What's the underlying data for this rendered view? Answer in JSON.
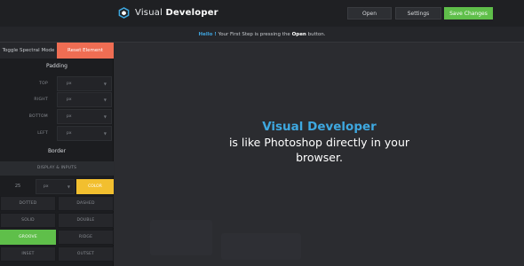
{
  "topbar": {
    "app_name_light": "Visual",
    "app_name_bold": "Developer",
    "logo_icon": "hexagon-logo-icon",
    "buttons": {
      "open": "Open",
      "settings": "Settings",
      "save": "Save Changes"
    },
    "save_color": "#5fbf4a"
  },
  "hint": {
    "hello": "Hello !",
    "text_before": "Your First Step is pressing the",
    "open_word": "Open",
    "text_after": "button."
  },
  "panel": {
    "spectral_button": "Toggle Spectral Mode",
    "reset_button": "Reset Element",
    "reset_color": "#ef6d53",
    "padding_title": "Padding",
    "padding_rows": [
      {
        "label": "TOP",
        "unit": "px"
      },
      {
        "label": "RIGHT",
        "unit": "px"
      },
      {
        "label": "BOTTOM",
        "unit": "px"
      },
      {
        "label": "LEFT",
        "unit": "px"
      }
    ],
    "border_title": "Border",
    "display_bar": "DISPLAY & INPUTS",
    "border_value": "25",
    "border_unit": "px",
    "color_button": "COLOR",
    "color_button_color": "#f2bf2f",
    "styles": [
      "DOTTED",
      "DASHED",
      "SOLID",
      "DOUBLE",
      "GROOVE",
      "RIDGE",
      "INSET",
      "OUTSET"
    ],
    "active_style": "GROOVE"
  },
  "main": {
    "brand": "Visual Developer",
    "tagline_line1": "is like Photoshop directly in your",
    "tagline_line2": "browser.",
    "brand_color": "#3ea8e0"
  }
}
